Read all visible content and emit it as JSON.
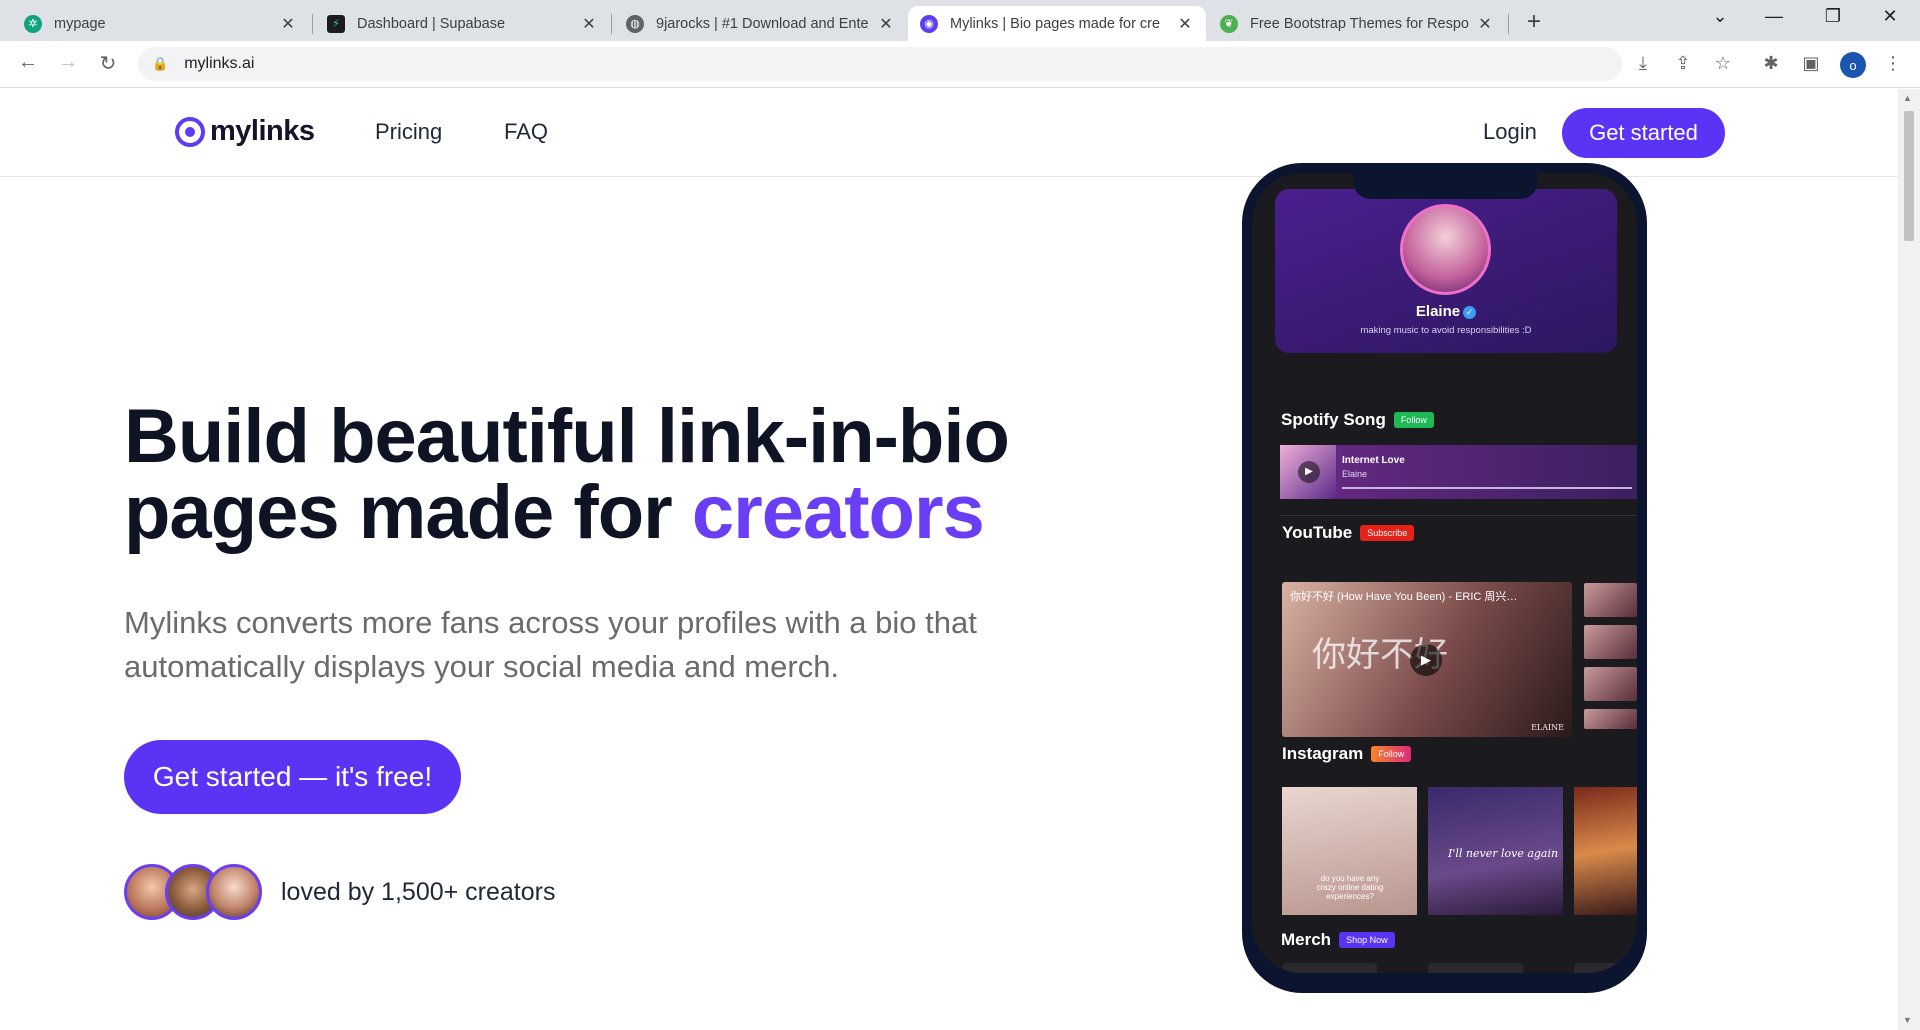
{
  "browser": {
    "tabs": [
      {
        "title": "mypage",
        "close": "✕",
        "favicon_color": "#10a37f",
        "favicon_glyph": "✲"
      },
      {
        "title": "Dashboard | Supabase",
        "close": "✕",
        "favicon_color": "#1c1c1c",
        "favicon_glyph": "⚡"
      },
      {
        "title": "9jarocks | #1 Download and Ente",
        "close": "✕",
        "favicon_color": "#5f6368",
        "favicon_glyph": "◍"
      },
      {
        "title": "Mylinks | Bio pages made for cre",
        "close": "✕",
        "favicon_color": "#5b3df5",
        "favicon_glyph": "◉"
      },
      {
        "title": "Free Bootstrap Themes for Respo",
        "close": "✕",
        "favicon_color": "#4caf50",
        "favicon_glyph": "❦"
      }
    ],
    "new_tab": "+",
    "window_controls": {
      "dropdown": "⌄",
      "minimize": "—",
      "restore": "❐",
      "close": "✕"
    },
    "nav": {
      "back": "←",
      "forward": "→",
      "reload": "↻"
    },
    "url": "mylinks.ai",
    "lock_icon": "🔒",
    "toolbar_icons": {
      "install": "⤓",
      "share": "⇪",
      "bookmark": "☆",
      "extensions": "✱",
      "sidepanel": "▣",
      "menu": "⋮"
    },
    "profile_initial": "o"
  },
  "site": {
    "logo": "mylinks",
    "nav": {
      "pricing": "Pricing",
      "faq": "FAQ",
      "login": "Login",
      "get_started": "Get started"
    },
    "hero": {
      "headline_line1": "Build beautiful link-in-bio",
      "headline_line2_start": "pages made for ",
      "headline_accent": "creators",
      "subtitle": "Mylinks converts more fans across your profiles with a bio that automatically displays your social media and merch.",
      "cta": "Get started — it's free!",
      "social_proof": "loved by 1,500+ creators"
    },
    "colors": {
      "brand": "#5b33f5",
      "accent_text": "#6a3ef5"
    }
  },
  "phone": {
    "profile_name": "Elaine",
    "verified": "✓",
    "bio": "making music to avoid responsibilities :D",
    "spotify": {
      "title": "Spotify Song",
      "badge": "Follow",
      "song": "Internet Love",
      "artist": "Elaine",
      "play": "▶"
    },
    "youtube": {
      "title": "YouTube",
      "badge": "Subscribe",
      "video_caption": "你好不好 (How Have You Been) - ERIC 周兴…",
      "overlay_text": "你好不好",
      "watermark": "ELAINE",
      "play": "▶"
    },
    "instagram": {
      "title": "Instagram",
      "badge": "Follow",
      "post1_text": "do you have any crazy online dating experiences?",
      "post2_text": "I'll never love again"
    },
    "merch": {
      "title": "Merch",
      "badge": "Shop Now"
    }
  }
}
